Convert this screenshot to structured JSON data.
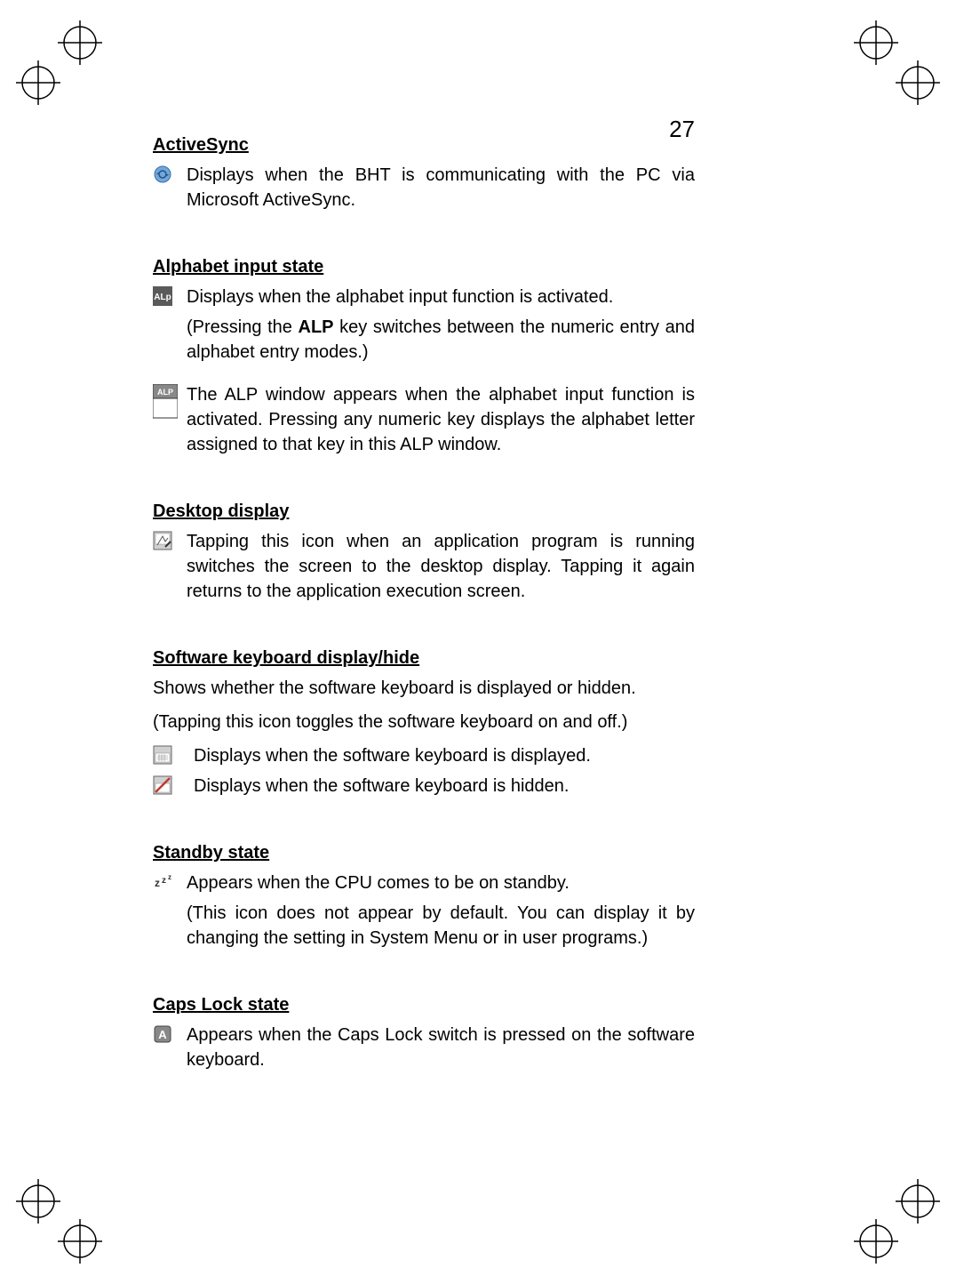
{
  "page_number": "27",
  "sections": {
    "activesync": {
      "heading": "ActiveSync",
      "text1": "Displays when the BHT is communicating with the PC via Microsoft ActiveSync."
    },
    "alphabet": {
      "heading": "Alphabet input state",
      "text1": "Displays when the alphabet input function is activated.",
      "text2a": "(Pressing the ",
      "text2b": "ALP",
      "text2c": " key switches between the numeric entry and alphabet entry modes.)",
      "text3": "The ALP window appears when the alphabet input function is activated. Pressing any numeric key displays the alphabet letter assigned to that key in this ALP window."
    },
    "desktop": {
      "heading": "Desktop display",
      "text1": "Tapping this icon when an application program is running switches the screen to the desktop display. Tapping it again returns to the application execution screen."
    },
    "software_kb": {
      "heading": "Software keyboard display/hide",
      "intro1": "Shows whether the software keyboard is displayed or hidden.",
      "intro2": "(Tapping this icon toggles the software keyboard on and off.)",
      "text1": "Displays when the software keyboard is displayed.",
      "text2": "Displays when the software keyboard is hidden."
    },
    "standby": {
      "heading": "Standby state",
      "text1": "Appears when the CPU comes to be on standby.",
      "text2": "(This icon does not appear by default. You can display it by changing the setting in System Menu or in user programs.)"
    },
    "capslock": {
      "heading": "Caps Lock state",
      "text1": "Appears when the Caps Lock switch is pressed on the software keyboard."
    }
  }
}
